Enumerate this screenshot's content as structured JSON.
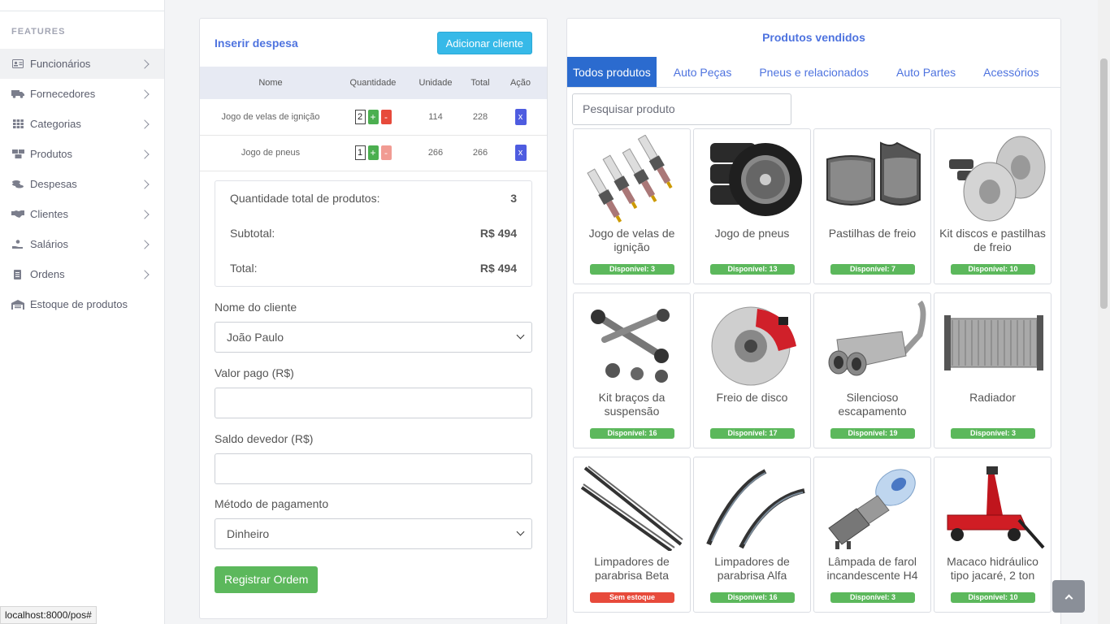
{
  "sidebar": {
    "heading": "FEATURES",
    "items": [
      {
        "label": "Funcionários",
        "icon": "id-card-icon",
        "active": true
      },
      {
        "label": "Fornecedores",
        "icon": "truck-icon"
      },
      {
        "label": "Categorias",
        "icon": "grid-icon"
      },
      {
        "label": "Produtos",
        "icon": "boxes-icon"
      },
      {
        "label": "Despesas",
        "icon": "coins-icon"
      },
      {
        "label": "Clientes",
        "icon": "handshake-icon"
      },
      {
        "label": "Salários",
        "icon": "hand-coins-icon"
      },
      {
        "label": "Ordens",
        "icon": "document-icon"
      },
      {
        "label": "Estoque de produtos",
        "icon": "warehouse-icon"
      }
    ]
  },
  "order": {
    "title": "Inserir despesa",
    "add_client_label": "Adicionar cliente",
    "columns": [
      "Nome",
      "Quantidade",
      "Unidade",
      "Total",
      "Ação"
    ],
    "rows": [
      {
        "name": "Jogo de velas de ignição",
        "qty": "2",
        "unit": "114",
        "total": "228"
      },
      {
        "name": "Jogo de pneus",
        "qty": "1",
        "unit": "266",
        "total": "266"
      }
    ],
    "plus": "+",
    "minus": "-",
    "remove": "x",
    "summary": {
      "qty_label": "Quantidade total de produtos:",
      "qty_value": "3",
      "subtotal_label": "Subtotal:",
      "subtotal_value": "R$ 494",
      "total_label": "Total:",
      "total_value": "R$ 494"
    },
    "client_label": "Nome do cliente",
    "client_value": "João Paulo",
    "paid_label": "Valor pago (R$)",
    "due_label": "Saldo devedor (R$)",
    "method_label": "Método de pagamento",
    "method_value": "Dinheiro",
    "submit_label": "Registrar Ordem"
  },
  "products": {
    "title": "Produtos vendidos",
    "tabs": [
      "Todos produtos",
      "Auto Peças",
      "Pneus e relacionados",
      "Auto Partes",
      "Acessórios"
    ],
    "search_placeholder": "Pesquisar produto",
    "items": [
      {
        "name": "Jogo de velas de ignição",
        "stock": "Disponível: 3"
      },
      {
        "name": "Jogo de pneus",
        "stock": "Disponível: 13"
      },
      {
        "name": "Pastilhas de freio",
        "stock": "Disponível: 7"
      },
      {
        "name": "Kit discos e pastilhas de freio",
        "stock": "Disponível: 10"
      },
      {
        "name": "Kit braços da suspensão",
        "stock": "Disponível: 16"
      },
      {
        "name": "Freio de disco",
        "stock": "Disponível: 17"
      },
      {
        "name": "Silencioso escapamento",
        "stock": "Disponível: 19"
      },
      {
        "name": "Radiador",
        "stock": "Disponível: 3"
      },
      {
        "name": "Limpadores de parabrisa Beta",
        "stock": "Sem estoque"
      },
      {
        "name": "Limpadores de parabrisa Alfa",
        "stock": "Disponível: 16"
      },
      {
        "name": "Lâmpada de farol incandescente H4",
        "stock": "Disponível: 3"
      },
      {
        "name": "Macaco hidráulico tipo jacaré, 2 ton",
        "stock": "Disponível: 10"
      }
    ]
  },
  "status_url": "localhost:8000/pos#"
}
